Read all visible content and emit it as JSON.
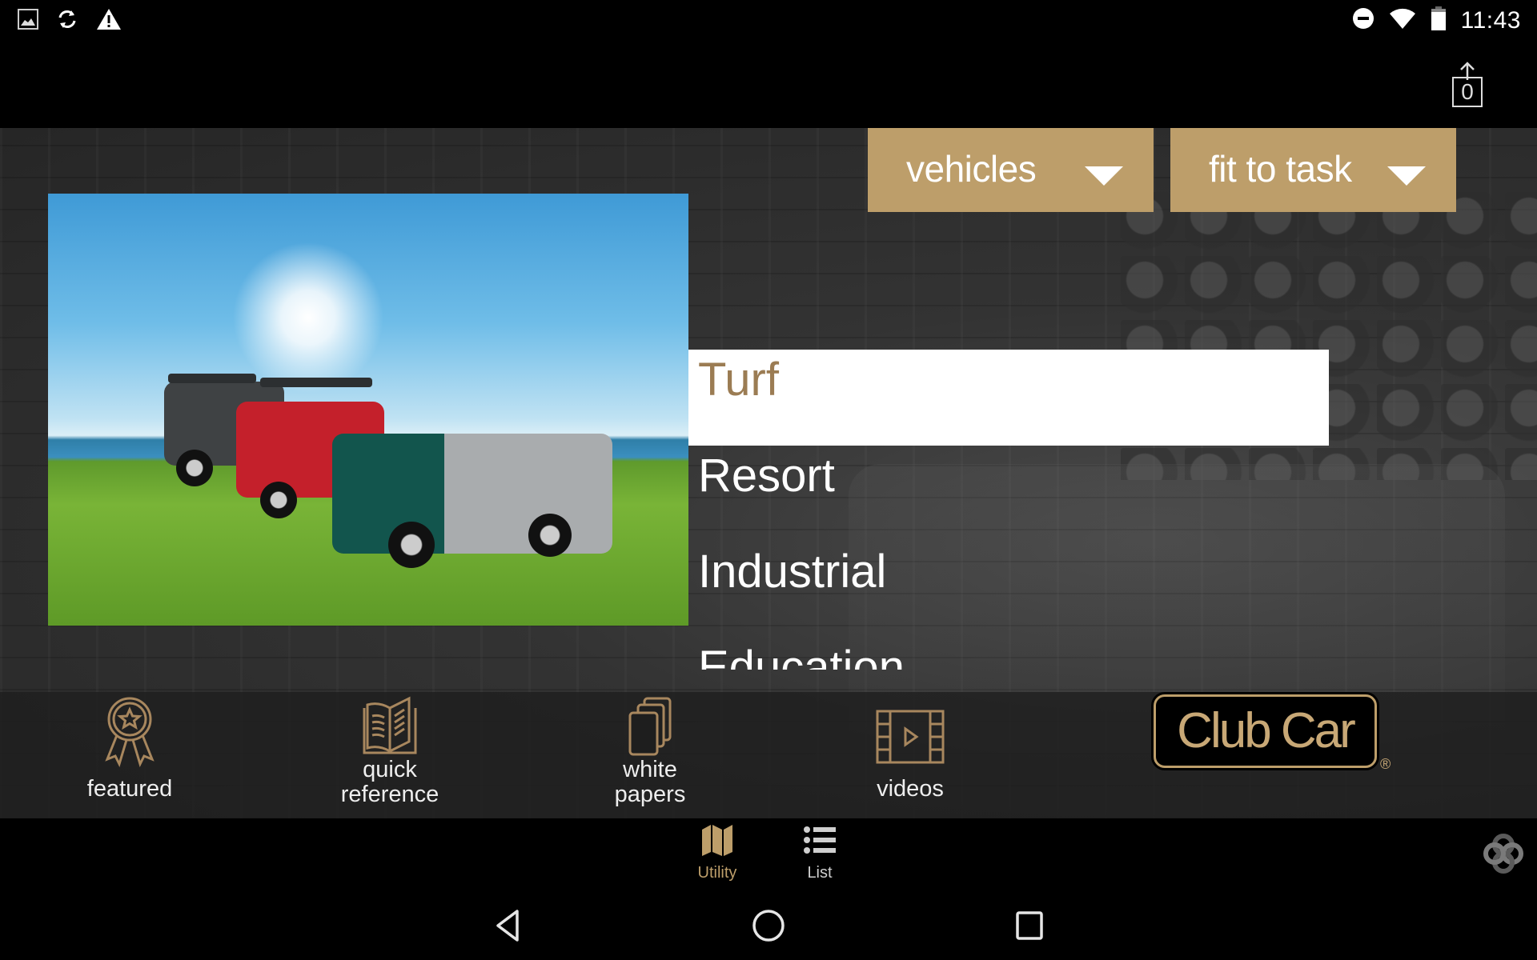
{
  "status_bar": {
    "left_icons": [
      "image-icon",
      "sync-icon",
      "warning-icon"
    ],
    "right_icons": [
      "do-not-disturb-icon",
      "wifi-icon",
      "battery-icon"
    ],
    "time": "11:43"
  },
  "action_bar": {
    "share_count": "0"
  },
  "dropdowns": {
    "vehicles": {
      "label": "vehicles"
    },
    "task": {
      "label": "fit to task"
    }
  },
  "categories": {
    "selected": "Turf",
    "items": [
      {
        "label": "Turf"
      },
      {
        "label": "Resort"
      },
      {
        "label": "Industrial"
      },
      {
        "label": "Education"
      }
    ]
  },
  "tiles": [
    {
      "label_line1": "featured",
      "label_line2": ""
    },
    {
      "label_line1": "quick",
      "label_line2": "reference"
    },
    {
      "label_line1": "white",
      "label_line2": "papers"
    },
    {
      "label_line1": "videos",
      "label_line2": ""
    }
  ],
  "brand": {
    "logo_text": "Club Car",
    "registered_mark": "®",
    "accent_color": "#bd9e6a"
  },
  "bottom_nav": {
    "items": [
      {
        "label": "Utility",
        "active": true
      },
      {
        "label": "List",
        "active": false
      }
    ]
  }
}
